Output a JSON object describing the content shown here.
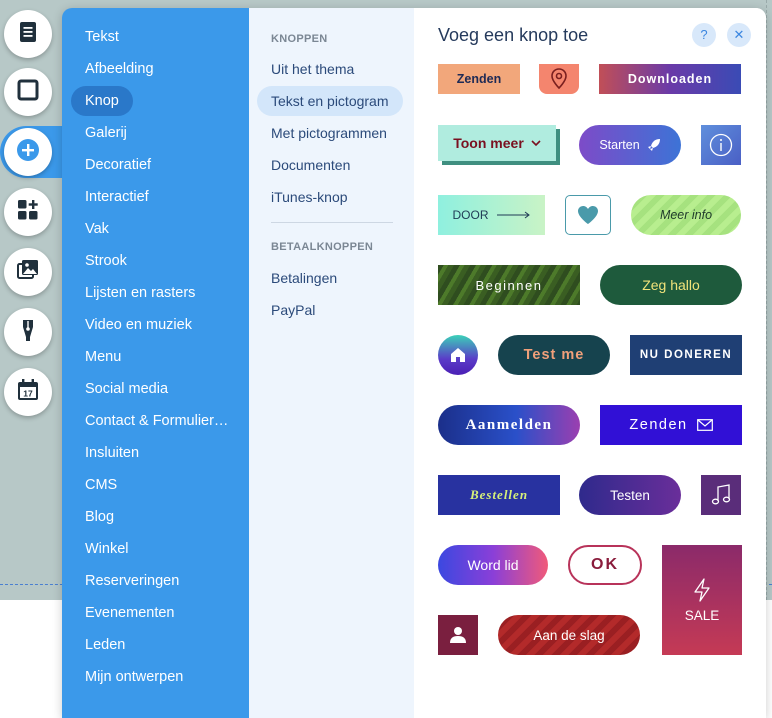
{
  "sidebar_categories": [
    "Tekst",
    "Afbeelding",
    "Knop",
    "Galerij",
    "Decoratief",
    "Interactief",
    "Vak",
    "Strook",
    "Lijsten en rasters",
    "Video en muziek",
    "Menu",
    "Social media",
    "Contact & Formulier…",
    "Insluiten",
    "CMS",
    "Blog",
    "Winkel",
    "Reserveringen",
    "Evenementen",
    "Leden",
    "Mijn ontwerpen"
  ],
  "selected_category": "Knop",
  "subcategories": {
    "heading_buttons": "KNOPPEN",
    "buttons": [
      "Uit het thema",
      "Tekst en pictogram",
      "Met pictogrammen",
      "Documenten",
      "iTunes-knop"
    ],
    "heading_payment": "BETAALKNOPPEN",
    "payment": [
      "Betalingen",
      "PayPal"
    ]
  },
  "selected_subcategory": "Tekst en pictogram",
  "panel": {
    "title": "Voeg een knop toe",
    "help_label": "?",
    "close_label": "✕"
  },
  "buttons": {
    "zenden_1": "Zenden",
    "downloaden": "Downloaden",
    "toon_meer": "Toon meer",
    "starten": "Starten",
    "door": "DOOR",
    "meer_info": "Meer info",
    "beginnen": "Beginnen",
    "zeg_hallo": "Zeg hallo",
    "test_me": "Test me",
    "nu_doneren": "NU DONEREN",
    "aanmelden": "Aanmelden",
    "zenden_2": "Zenden",
    "bestellen": "Bestellen",
    "testen": "Testen",
    "word_lid": "Word lid",
    "ok": "OK",
    "sale": "SALE",
    "aan_de_slag": "Aan de slag"
  },
  "rail_icons": [
    "pages-icon",
    "background-icon",
    "add-icon",
    "app-market-icon",
    "media-icon",
    "pen-icon",
    "calendar-icon"
  ],
  "calendar_day": "17",
  "colors": {
    "accent": "#3b99ea",
    "selected_category": "#2a78c9",
    "subcategory_bg": "#eef5fd",
    "title": "#253a5c"
  }
}
